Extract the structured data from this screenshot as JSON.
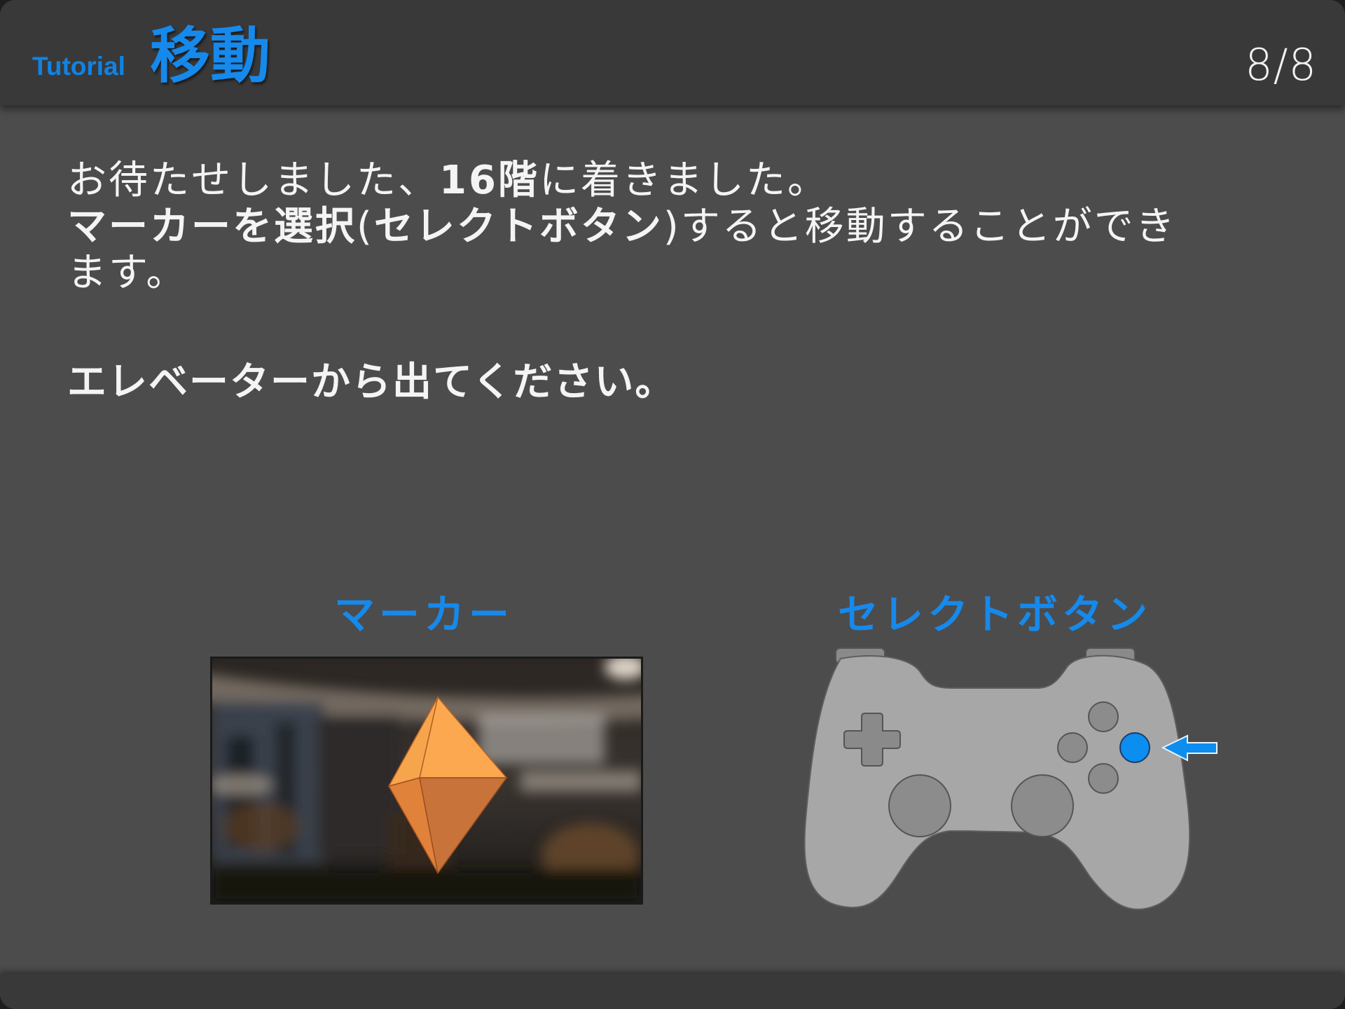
{
  "header": {
    "tutorial_label": "Tutorial",
    "title": "移動",
    "page_counter": "8/8"
  },
  "message": {
    "line1_pre": "お待たせしました、",
    "line1_bold": "16階",
    "line1_post": "に着きました。",
    "line2_bold1": "マーカーを選択",
    "line2_paren_open": "(",
    "line2_bold2": "セレクトボタン",
    "line2_paren_close": ")",
    "line2_post": "すると移動することができ",
    "line3": "ます。",
    "instruction": "エレベーターから出てください。"
  },
  "captions": {
    "marker": "マーカー",
    "select_button": "セレクトボタン"
  },
  "colors": {
    "accent": "#1689ec",
    "panel_background": "#4c4c4c",
    "header_background": "#393939",
    "marker_orange": "#f39a45",
    "controller_body": "#a6a6a6",
    "highlight_button": "#0c8df0"
  },
  "icons": {
    "marker": "orange-octahedron-marker",
    "controller": "gamepad-icon",
    "pointer": "left-arrow-icon"
  }
}
